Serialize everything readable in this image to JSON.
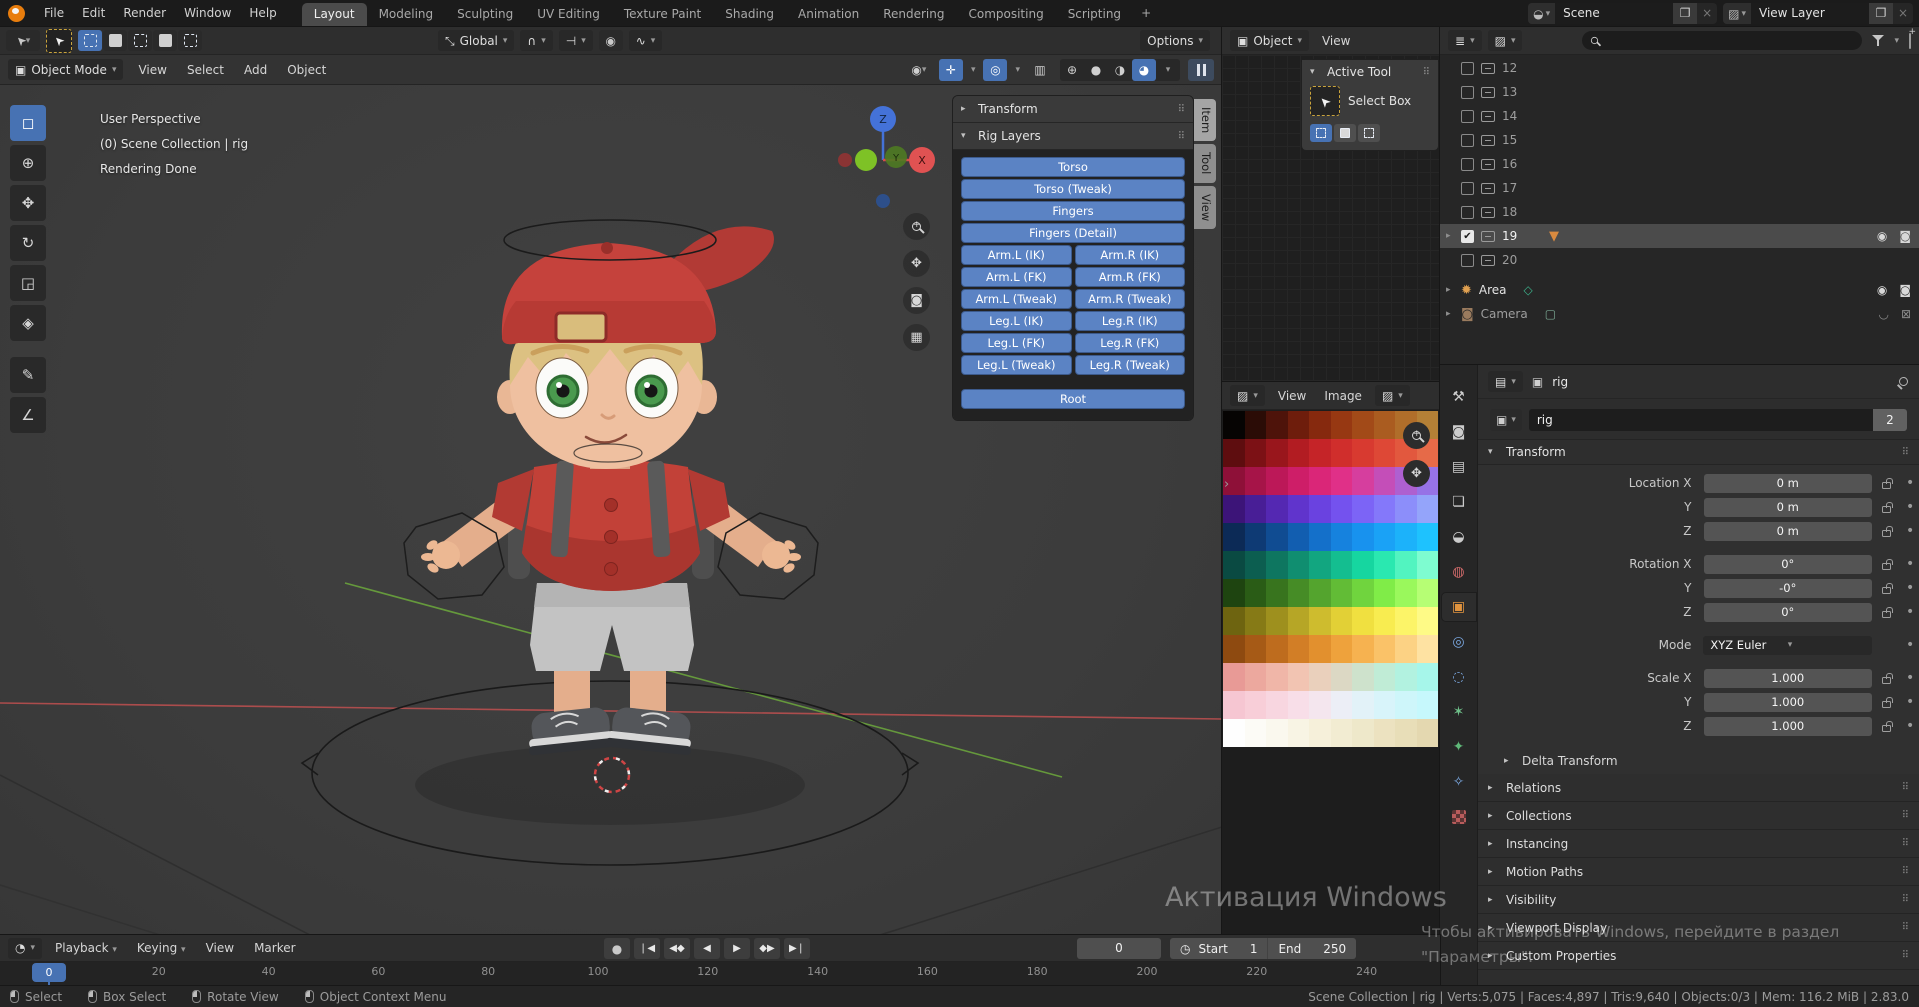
{
  "colors": {
    "accent_blue": "#4772b3",
    "rig_button_blue": "#5b83c4",
    "header_dark": "#2e2e2e",
    "viewport_grey": "#3d3d3d"
  },
  "topbar": {
    "menus": [
      "File",
      "Edit",
      "Render",
      "Window",
      "Help"
    ],
    "workspaces": [
      "Layout",
      "Modeling",
      "Sculpting",
      "UV Editing",
      "Texture Paint",
      "Shading",
      "Animation",
      "Rendering",
      "Compositing",
      "Scripting"
    ],
    "active_workspace": "Layout",
    "add_workspace": "+",
    "scene_label": "Scene",
    "view_layer_label": "View Layer"
  },
  "tool_settings": {
    "orientation": "Global",
    "options_label": "Options"
  },
  "viewport": {
    "mode": "Object Mode",
    "menus": [
      "View",
      "Select",
      "Add",
      "Object"
    ],
    "overlay_line1": "User Perspective",
    "overlay_line2": "(0) Scene Collection | rig",
    "overlay_line3": "Rendering Done",
    "axis_x": "X",
    "axis_y": "Y",
    "axis_z": "Z",
    "tools": [
      {
        "name": "select-box",
        "glyph": "◻",
        "active": true
      },
      {
        "name": "cursor",
        "glyph": "⊕"
      },
      {
        "name": "move",
        "glyph": "✥"
      },
      {
        "name": "rotate",
        "glyph": "↻"
      },
      {
        "name": "scale",
        "glyph": "◲"
      },
      {
        "name": "transform",
        "glyph": "◈"
      },
      {
        "name": "annotate",
        "glyph": "✎"
      },
      {
        "name": "measure",
        "glyph": "∠"
      }
    ]
  },
  "sidebar": {
    "transform_label": "Transform",
    "rig_layers_label": "Rig Layers",
    "buttons_top": [
      "Torso",
      "Torso (Tweak)",
      "Fingers",
      "Fingers (Detail)"
    ],
    "button_pairs": [
      [
        "Arm.L (IK)",
        "Arm.R (IK)"
      ],
      [
        "Arm.L (FK)",
        "Arm.R (FK)"
      ],
      [
        "Arm.L (Tweak)",
        "Arm.R (Tweak)"
      ],
      [
        "Leg.L (IK)",
        "Leg.R (IK)"
      ],
      [
        "Leg.L (FK)",
        "Leg.R (FK)"
      ],
      [
        "Leg.L (Tweak)",
        "Leg.R (Tweak)"
      ]
    ],
    "root_label": "Root",
    "tabs": [
      "Item",
      "Tool",
      "View"
    ],
    "active_tab": "Item"
  },
  "mini_viewport": {
    "mode": "Object",
    "menu": "View",
    "panel_title": "Active Tool",
    "tool_name": "Select Box"
  },
  "image_editor": {
    "menus": [
      "View",
      "Image"
    ],
    "palette_rows": [
      [
        "#060403",
        "#2b0c06",
        "#4e130a",
        "#6e1d0c",
        "#86290e",
        "#973812",
        "#a24a18",
        "#aa5c20",
        "#b06e2a",
        "#b48036"
      ],
      [
        "#5e0d0f",
        "#7c1115",
        "#99161c",
        "#b21c22",
        "#c52428",
        "#d02e2c",
        "#d83a30",
        "#de4836",
        "#e2583e",
        "#e66a48"
      ],
      [
        "#8e1038",
        "#a61448",
        "#bc1858",
        "#ce1e68",
        "#da2678",
        "#e03088",
        "#d63e9e",
        "#c44eb8",
        "#ae60d0",
        "#9672e6"
      ],
      [
        "#3c1478",
        "#481e96",
        "#5428b2",
        "#6034cc",
        "#6a42e0",
        "#7452ee",
        "#7c64f6",
        "#8478fa",
        "#8c8efa",
        "#94a4fa"
      ],
      [
        "#0c2a56",
        "#0e3a74",
        "#104c92",
        "#125eb0",
        "#1470ca",
        "#1682de",
        "#1892ee",
        "#1aa2f6",
        "#1cb2fa",
        "#1ec2fe"
      ],
      [
        "#0a4a42",
        "#0c5e50",
        "#0e7660",
        "#108e70",
        "#12a680",
        "#14be90",
        "#16d6a0",
        "#2ae8b0",
        "#52f4c0",
        "#7efcd0"
      ],
      [
        "#1e4410",
        "#2a5c16",
        "#38741e",
        "#468c26",
        "#54a42e",
        "#62bc36",
        "#70d43e",
        "#80ec48",
        "#9af85c",
        "#b6fe74"
      ],
      [
        "#6e6410",
        "#867a16",
        "#9e901e",
        "#b6a626",
        "#cebc2e",
        "#e2d036",
        "#f0e040",
        "#f8ec50",
        "#fcf468",
        "#fefa86"
      ],
      [
        "#8e4a10",
        "#a65a16",
        "#be6c1e",
        "#d27e26",
        "#e2902e",
        "#eea23c",
        "#f6b250",
        "#fac268",
        "#fcd284",
        "#fee2a2"
      ],
      [
        "#e89a96",
        "#eca89e",
        "#f0b6a8",
        "#f2c4b2",
        "#ead0bc",
        "#dcd8c4",
        "#cee2cc",
        "#c0ecd6",
        "#b2f2e0",
        "#a6f6ea"
      ],
      [
        "#f6c6d2",
        "#f8ced8",
        "#f8d6e0",
        "#f8dee8",
        "#f4e6ee",
        "#eceef6",
        "#e2f2f8",
        "#d8f4fa",
        "#cef6fa",
        "#c6f8fc"
      ],
      [
        "#fefefe",
        "#fcfbf6",
        "#faf8ee",
        "#f8f4e4",
        "#f6f0da",
        "#f2ecd2",
        "#eee8ca",
        "#ece2c0",
        "#e8deb8",
        "#e4d8b0"
      ]
    ]
  },
  "outliner": {
    "rows": [
      {
        "label": "12"
      },
      {
        "label": "13"
      },
      {
        "label": "14"
      },
      {
        "label": "15"
      },
      {
        "label": "16"
      },
      {
        "label": "17"
      },
      {
        "label": "18"
      },
      {
        "label": "19",
        "checked": true,
        "selected": true,
        "armature": true
      },
      {
        "label": "20"
      }
    ],
    "area_label": "Area",
    "camera_label": "Camera"
  },
  "properties": {
    "breadcrumb_object": "rig",
    "name_value": "rig",
    "users_count": "2",
    "transform_title": "Transform",
    "rows": [
      {
        "label": "Location X",
        "value": "0 m"
      },
      {
        "label": "Y",
        "value": "0 m"
      },
      {
        "label": "Z",
        "value": "0 m"
      },
      {
        "label": "Rotation X",
        "value": "0°",
        "gap": true
      },
      {
        "label": "Y",
        "value": "-0°"
      },
      {
        "label": "Z",
        "value": "0°"
      },
      {
        "label": "Mode",
        "value": "XYZ Euler",
        "dropdown": true,
        "gap": true
      },
      {
        "label": "Scale X",
        "value": "1.000",
        "gap": true
      },
      {
        "label": "Y",
        "value": "1.000"
      },
      {
        "label": "Z",
        "value": "1.000"
      }
    ],
    "sub_section": "Delta Transform",
    "sections": [
      "Relations",
      "Collections",
      "Instancing",
      "Motion Paths",
      "Visibility",
      "Viewport Display",
      "Custom Properties"
    ],
    "tabs": [
      {
        "name": "tool",
        "glyph": "⚒",
        "color": "#cccccc"
      },
      {
        "name": "render",
        "glyph": "◙",
        "color": "#cccccc"
      },
      {
        "name": "output",
        "glyph": "▤",
        "color": "#cccccc"
      },
      {
        "name": "view-layer",
        "glyph": "❏",
        "color": "#cccccc"
      },
      {
        "name": "scene",
        "glyph": "◒",
        "color": "#cccccc"
      },
      {
        "name": "world",
        "glyph": "◍",
        "color": "#cf6a6a"
      },
      {
        "name": "object",
        "glyph": "▣",
        "color": "#e0933e",
        "active": true
      },
      {
        "name": "physics-orbit",
        "glyph": "◎",
        "color": "#7aa7e0"
      },
      {
        "name": "physics",
        "glyph": "◌",
        "color": "#7aa7e0"
      },
      {
        "name": "object-data",
        "glyph": "✶",
        "color": "#6fc08a"
      },
      {
        "name": "bone",
        "glyph": "✦",
        "color": "#5fb878"
      },
      {
        "name": "bone-constraint",
        "glyph": "✧",
        "color": "#7aa7e0"
      }
    ]
  },
  "timeline": {
    "menus": [
      "Playback",
      "Keying",
      "View",
      "Marker"
    ],
    "current_frame": "0",
    "start_label": "Start",
    "start_value": "1",
    "end_label": "End",
    "end_value": "250",
    "ticks": [
      "0",
      "20",
      "40",
      "60",
      "80",
      "100",
      "120",
      "140",
      "160",
      "180",
      "200",
      "220",
      "240"
    ]
  },
  "status_bar": {
    "hints": [
      "Select",
      "Box Select",
      "Rotate View",
      "Object Context Menu"
    ],
    "info": "Scene Collection | rig | Verts:5,075 | Faces:4,897 | Tris:9,640 | Objects:0/3 | Mem: 116.2 MiB | 2.83.0"
  },
  "watermark": {
    "title": "Активация Windows",
    "line1": "Чтобы активировать Windows, перейдите в раздел",
    "line2": "\"Параметры\"."
  }
}
